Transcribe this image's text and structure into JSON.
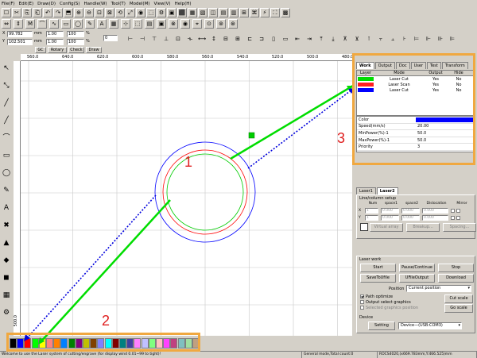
{
  "menu": [
    "File(F)",
    "Edit(E)",
    "Draw(D)",
    "Config(S)",
    "Handle(W)",
    "Tool(T)",
    "Model(M)",
    "View(V)",
    "Help(H)"
  ],
  "toolbar_fields": {
    "x_label": "X",
    "x_value": "99.782",
    "x_unit": "mm",
    "y_label": "Y",
    "y_value": "102.501",
    "y_unit": "mm",
    "w_value": "1.00",
    "h_value": "1.00",
    "pct1": "100",
    "pct2": "100",
    "pct_unit": "%",
    "rotate_value": "0"
  },
  "text_buttons": {
    "check": "Check",
    "draw": "Draw",
    "gc": "GC",
    "rotary": "Rotary"
  },
  "ruler_top": [
    "560.0",
    "640.0",
    "620.0",
    "600.0",
    "580.0",
    "560.0",
    "540.0",
    "520.0",
    "500.0",
    "480.0"
  ],
  "ruler_left": [
    "500.0"
  ],
  "colors": {
    "accent_box": "#f0a840",
    "annot": "#e02020",
    "green": "#00cc00",
    "red": "#ff0000",
    "blue": "#0000ff"
  },
  "annotations": {
    "n1": "1",
    "n2": "2",
    "n3": "3"
  },
  "panel": {
    "tabs": [
      "Work",
      "Output",
      "Doc",
      "User",
      "Test",
      "Transform"
    ],
    "layer_headers": [
      "Layer",
      "Mode",
      "Output",
      "Hide"
    ],
    "layers": [
      {
        "color": "#00dd00",
        "mode": "Laser Cut",
        "output": "Yes",
        "hide": "No"
      },
      {
        "color": "#ff2020",
        "mode": "Laser Scan",
        "output": "Yes",
        "hide": "No"
      },
      {
        "color": "#0000ff",
        "mode": "Laser Cut",
        "output": "Yes",
        "hide": "No"
      }
    ],
    "props": [
      {
        "label": "Color",
        "value": ""
      },
      {
        "label": "Speed(mm/s)",
        "value": "20.00"
      },
      {
        "label": "MinPower(%)-1",
        "value": "50.0"
      },
      {
        "label": "MaxPower(%)-1",
        "value": "50.0"
      },
      {
        "label": "Priority",
        "value": "3"
      }
    ],
    "laser_tabs": [
      "Laser1",
      "Laser2"
    ],
    "array_title": "Line/column setup",
    "array_headers": [
      "Num",
      "space1",
      "space2",
      "Dislocation",
      "Mirror"
    ],
    "array_rows": [
      {
        "axis": "X",
        "num": "1",
        "s1": "0.000",
        "s2": "0.000",
        "dis": "0.000"
      },
      {
        "axis": "Y",
        "num": "1",
        "s1": "0.000",
        "s2": "0.000",
        "dis": "0.000"
      }
    ],
    "array_buttons": [
      "Virtual array",
      "Breakup...",
      "Spacing..."
    ],
    "laserwork_title": "Laser work",
    "work_buttons": [
      "Start",
      "Pause/Continue",
      "Stop",
      "SaveToUfile",
      "UFileOutput",
      "Download"
    ],
    "position_label": "Position",
    "position_value": "Current position",
    "checks": [
      {
        "label": "Path optimize",
        "on": true
      },
      {
        "label": "Output select graphics",
        "on": false
      },
      {
        "label": "Selected graphics position",
        "on": false
      }
    ],
    "side_buttons": [
      "Cut scale",
      "Go scale"
    ],
    "device_title": "Device",
    "setting_button": "Setting",
    "device_value": "Device—(USB:COM3)"
  },
  "palette_colors": [
    "#000000",
    "#0000ff",
    "#ff0000",
    "#00ff00",
    "#ffff00",
    "#ff8080",
    "#ff8000",
    "#0080ff",
    "#008000",
    "#800080",
    "#c0c000",
    "#804000",
    "#8080ff",
    "#00ffff",
    "#800000",
    "#008080",
    "#4040a0",
    "#ff80ff",
    "#c0c0ff",
    "#80ff80",
    "#ffc0c0",
    "#ff40ff",
    "#c04080",
    "#80c0c0",
    "#a0e0a0",
    "#c0a080"
  ],
  "status": {
    "left": "Welcome to use the Laser system of cutting/engrave (for display wind 0.01~99 to tight)!",
    "mid": "General mode,Total count:0",
    "right": "ROCS4020,(x669.783mm,Y:466.525)mm"
  }
}
